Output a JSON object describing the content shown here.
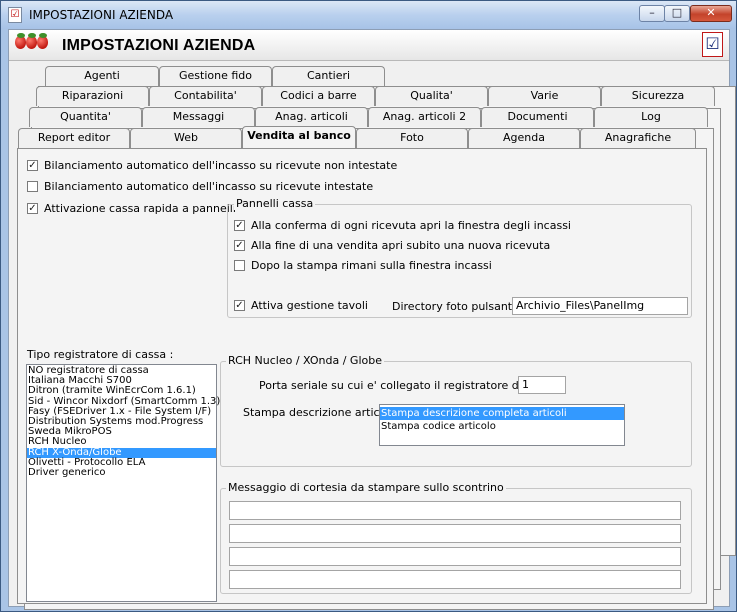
{
  "window": {
    "title": "IMPOSTAZIONI AZIENDA",
    "minimize": "–",
    "maximize": "□",
    "close": "✕"
  },
  "header": {
    "title": "IMPOSTAZIONI AZIENDA",
    "checklist_icon": "checklist-icon",
    "logo_icon": "strawberry-icon"
  },
  "tabs": {
    "row1": [
      "Agenti",
      "Gestione fido",
      "Cantieri"
    ],
    "row2": [
      "Riparazioni",
      "Contabilita'",
      "Codici a barre",
      "Qualita'",
      "Varie",
      "Sicurezza"
    ],
    "row3": [
      "Quantita'",
      "Messaggi",
      "Anag. articoli",
      "Anag. articoli 2",
      "Documenti",
      "Log"
    ],
    "row4": [
      "Report editor",
      "Web",
      "Vendita al banco",
      "Foto",
      "Agenda",
      "Anagrafiche"
    ],
    "active": "Vendita al banco"
  },
  "options": {
    "bilanciamento_non_intestate": {
      "label": "Bilanciamento automatico dell'incasso su ricevute non intestate",
      "checked": true
    },
    "bilanciamento_intestate": {
      "label": "Bilanciamento automatico dell'incasso su ricevute intestate",
      "checked": false
    },
    "cassa_rapida": {
      "label": "Attivazione cassa rapida a pannelli",
      "checked": true
    }
  },
  "pannelli": {
    "title": "Pannelli cassa",
    "conferma": {
      "label": "Alla conferma di ogni ricevuta apri la finestra degli incassi",
      "checked": true
    },
    "fine_vendita": {
      "label": "Alla fine di una vendita apri subito una nuova ricevuta",
      "checked": true
    },
    "dopo_stampa": {
      "label": "Dopo la stampa rimani sulla finestra incassi",
      "checked": false
    },
    "tavoli": {
      "label": "Attiva gestione tavoli",
      "checked": true
    },
    "directory_label": "Directory foto pulsanti :",
    "directory_value": "Archivio_Files\\PanelImg"
  },
  "registratore": {
    "label": "Tipo registratore di cassa :",
    "items": [
      "NO registratore di cassa",
      "Italiana Macchi S700",
      "Ditron (tramite WinEcrCom 1.6.1)",
      "Sid - Wincor Nixdorf (SmartComm 1.3)",
      "Fasy (FSEDriver 1.x - File System I/F)",
      "Distribution Systems mod.Progress",
      "Sweda MikroPOS",
      "RCH Nucleo",
      "RCH X-Onda/Globe",
      "Olivetti - Protocollo ELA",
      "Driver generico"
    ],
    "selected": "RCH X-Onda/Globe"
  },
  "rch": {
    "title": "RCH Nucleo / XOnda / Globe",
    "porta_label": "Porta seriale su cui e' collegato il registratore di cassa :",
    "porta_value": "1",
    "stampa_label": "Stampa descrizione articoli :",
    "stampa_items": [
      "Stampa descrizione completa articoli",
      "Stampa codice articolo"
    ],
    "stampa_selected": "Stampa descrizione completa articoli"
  },
  "messaggio": {
    "title": "Messaggio di cortesia da stampare sullo scontrino",
    "lines": [
      "",
      "",
      "",
      "",
      ""
    ]
  }
}
